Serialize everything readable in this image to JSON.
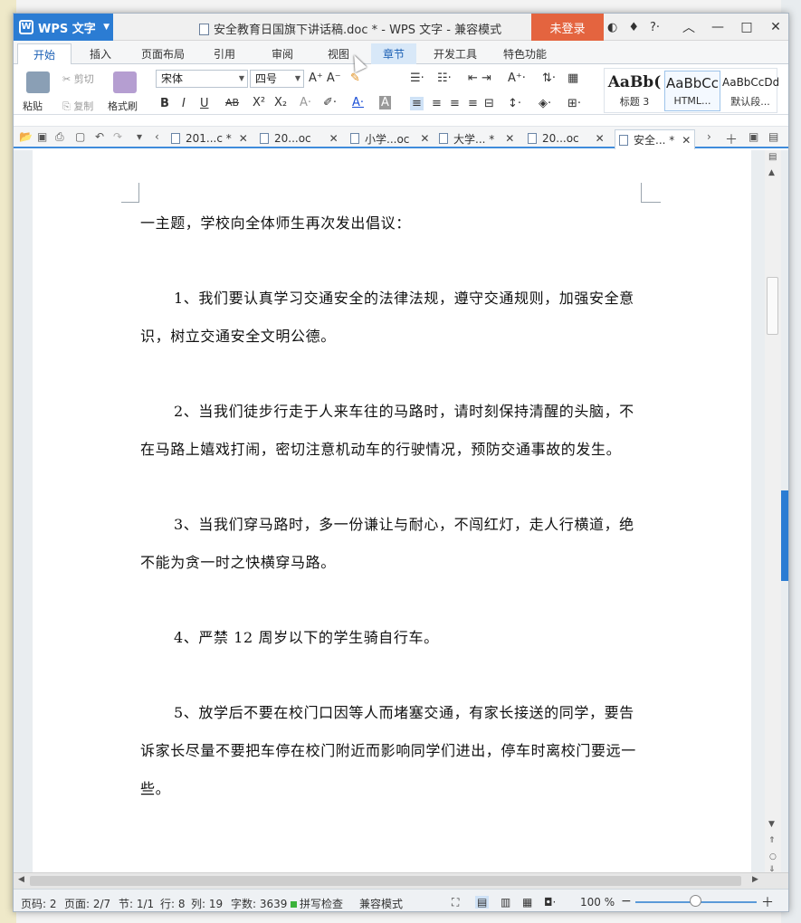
{
  "app": {
    "name": "WPS 文字",
    "title": "安全教育日国旗下讲话稿.doc * - WPS 文字 - 兼容模式",
    "login": "未登录",
    "window_controls": [
      "minimize-icon",
      "restore-icon",
      "maximize-icon",
      "close-icon"
    ]
  },
  "tabs": [
    "开始",
    "插入",
    "页面布局",
    "引用",
    "审阅",
    "视图",
    "章节",
    "开发工具",
    "特色功能"
  ],
  "ribbon": {
    "paste": "粘贴",
    "cut": "剪切",
    "copy": "复制",
    "format_painter": "格式刷",
    "font_name": "宋体",
    "font_size": "四号",
    "bold": "B",
    "italic": "I",
    "underline": "U",
    "strike": "AB",
    "superscript": "X²",
    "subscript": "X₂",
    "styles": [
      {
        "sample": "AaBb(",
        "label": "标题 3"
      },
      {
        "sample": "AaBbCc",
        "label": "HTML..."
      },
      {
        "sample": "AaBbCcDd",
        "label": "默认段..."
      }
    ]
  },
  "doc_tabs": [
    {
      "label": "201...c *"
    },
    {
      "label": "20...oc"
    },
    {
      "label": "小学...oc"
    },
    {
      "label": "大学... *"
    },
    {
      "label": "20...oc"
    },
    {
      "label": "安全... *"
    }
  ],
  "document": {
    "paragraphs": [
      {
        "text": "一主题，学校向全体师生再次发出倡议：",
        "indent": false
      },
      {
        "text": "",
        "indent": false
      },
      {
        "text": "1、我们要认真学习交通安全的法律法规，遵守交通规则，加强安全意识，树立交通安全文明公德。",
        "indent": true
      },
      {
        "text": "",
        "indent": false
      },
      {
        "text": "2、当我们徒步行走于人来车往的马路时，请时刻保持清醒的头脑，不在马路上嬉戏打闹，密切注意机动车的行驶情况，预防交通事故的发生。",
        "indent": true
      },
      {
        "text": "",
        "indent": false
      },
      {
        "text": "3、当我们穿马路时，多一份谦让与耐心，不闯红灯，走人行横道，绝不能为贪一时之快横穿马路。",
        "indent": true
      },
      {
        "text": "",
        "indent": false
      },
      {
        "text": "4、严禁 12 周岁以下的学生骑自行车。",
        "indent": true
      },
      {
        "text": "",
        "indent": false
      },
      {
        "text": "5、放学后不要在校门口因等人而堵塞交通，有家长接送的同学，要告诉家长尽量不要把车停在校门附近而影响同学们进出，停车时离校门要远一些。",
        "indent": true
      }
    ]
  },
  "status": {
    "page_code": "页码: 2",
    "pages": "页面: 2/7",
    "section": "节: 1/1",
    "row": "行: 8",
    "col": "列: 19",
    "word_count": "字数: 3639",
    "spell_check": "拼写检查",
    "compat_mode": "兼容模式",
    "zoom": "100 %"
  },
  "colors": {
    "accent": "#2b7cd3",
    "login_bg": "#e4643f"
  }
}
